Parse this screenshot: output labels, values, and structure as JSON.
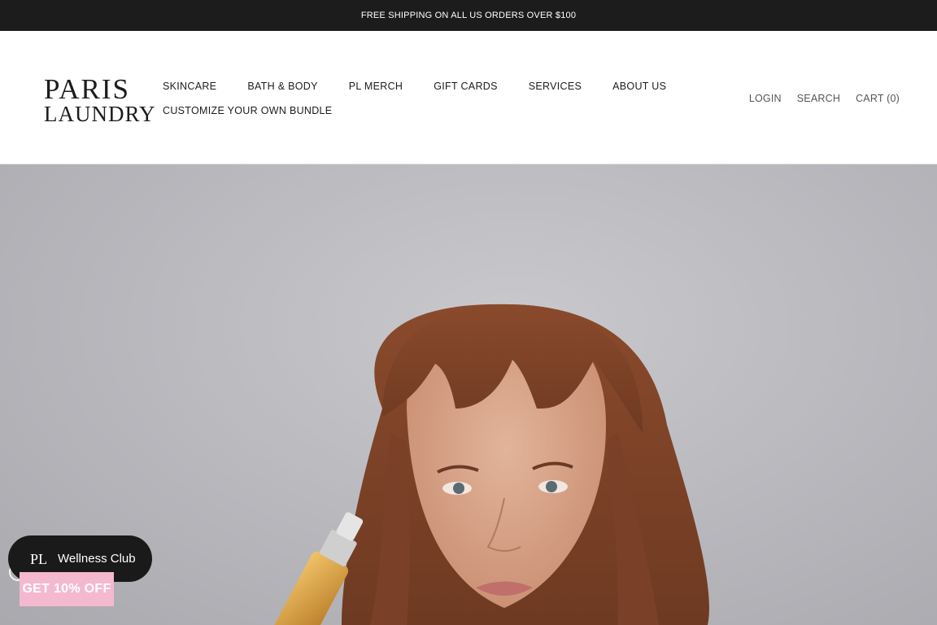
{
  "announcement": {
    "text": "FREE SHIPPING ON ALL US ORDERS OVER $100"
  },
  "header": {
    "logo": {
      "line1": "PARIS",
      "line2": "LAUNDRY"
    },
    "nav": {
      "row1": [
        "SKINCARE",
        "BATH & BODY",
        "PL MERCH",
        "GIFT CARDS",
        "SERVICES",
        "ABOUT US"
      ],
      "row2": [
        "CUSTOMIZE YOUR OWN BUNDLE"
      ]
    },
    "actions": {
      "login": "LOGIN",
      "search": "SEARCH",
      "cart": "CART (0)"
    }
  },
  "hero": {
    "image": "woman-with-serum-dropper-photo"
  },
  "widgets": {
    "wellness_club": {
      "logo_text": "PL",
      "label": "Wellness Club"
    },
    "discount": {
      "label": "GET 10% OFF"
    }
  },
  "colors": {
    "announcement_bg": "#1c1c1c",
    "wellness_bg": "#1a1a1a",
    "discount_bg": "#f4b9cf",
    "hero_bg": "#bdbdc2"
  }
}
